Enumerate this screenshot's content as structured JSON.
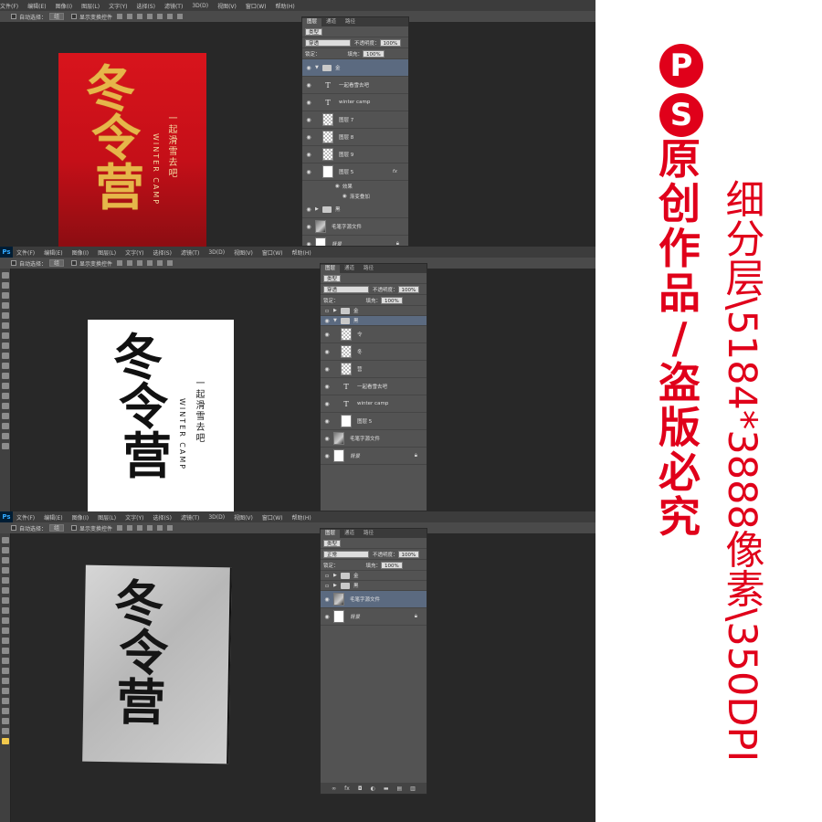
{
  "menu": {
    "logo": "Ps",
    "items": [
      "文件(F)",
      "编辑(E)",
      "图像(I)",
      "图层(L)",
      "文字(Y)",
      "选择(S)",
      "滤镜(T)",
      "3D(D)",
      "视图(V)",
      "窗口(W)",
      "帮助(H)"
    ]
  },
  "options": {
    "auto_select_label": "自动选择：",
    "auto_select_value": "组",
    "show_transform_label": "显示变换控件"
  },
  "artwork": {
    "calligraphy": [
      "冬",
      "令",
      "营"
    ],
    "subtitle_cn": "一起滑雪去吧",
    "subtitle_en": "WINTER CAMP"
  },
  "layers_panel": {
    "tabs": [
      "图层",
      "通道",
      "路径"
    ],
    "filter_kind": "类型",
    "blend_mode_pass": "穿透",
    "blend_mode_normal": "正常",
    "opacity_label": "不透明度：",
    "opacity_value": "100%",
    "lock_label": "锁定：",
    "fill_label": "填充：",
    "fill_value": "100%"
  },
  "panel1": {
    "layers": [
      {
        "name": "金",
        "kind": "group-open"
      },
      {
        "name": "一起看雪去吧",
        "kind": "text"
      },
      {
        "name": "winter camp",
        "kind": "text"
      },
      {
        "name": "图层 7",
        "kind": "checker"
      },
      {
        "name": "图层 8",
        "kind": "checker"
      },
      {
        "name": "图层 9",
        "kind": "checker"
      },
      {
        "name": "图层 5",
        "kind": "white",
        "fx": "fx"
      }
    ],
    "effects_label": "效果",
    "effect_item": "渐变叠加",
    "after": [
      {
        "name": "黑",
        "kind": "group-closed"
      },
      {
        "name": "毛笔字源文件",
        "kind": "photo"
      },
      {
        "name": "背景",
        "kind": "background"
      }
    ]
  },
  "panel2": {
    "layers": [
      {
        "name": "金",
        "kind": "group-closed"
      },
      {
        "name": "黑",
        "kind": "group-open"
      },
      {
        "name": "令",
        "kind": "checker"
      },
      {
        "name": "冬",
        "kind": "checker"
      },
      {
        "name": "营",
        "kind": "checker"
      },
      {
        "name": "一起看雪去吧",
        "kind": "text"
      },
      {
        "name": "winter camp",
        "kind": "text"
      },
      {
        "name": "图层 5",
        "kind": "white"
      },
      {
        "name": "毛笔字源文件",
        "kind": "photo"
      },
      {
        "name": "背景",
        "kind": "background"
      }
    ]
  },
  "panel3": {
    "layers": [
      {
        "name": "金",
        "kind": "group-closed"
      },
      {
        "name": "黑",
        "kind": "group-closed"
      },
      {
        "name": "毛笔字源文件",
        "kind": "photo",
        "selected": true
      },
      {
        "name": "背景",
        "kind": "background"
      }
    ],
    "bottom_icons": [
      "link",
      "fx",
      "mask",
      "adjust",
      "folder",
      "new",
      "trash"
    ]
  },
  "watermark": {
    "badge_letters": [
      "P",
      "S"
    ],
    "vertical_red": [
      "原",
      "创",
      "作",
      "品",
      "/",
      "盗",
      "版",
      "必",
      "究"
    ],
    "spec": "细分层\\5184*3888像素\\350DPI"
  },
  "colors": {
    "accent_red": "#e0001a",
    "ps_dark": "#282828",
    "gold": "#e6b64a"
  }
}
